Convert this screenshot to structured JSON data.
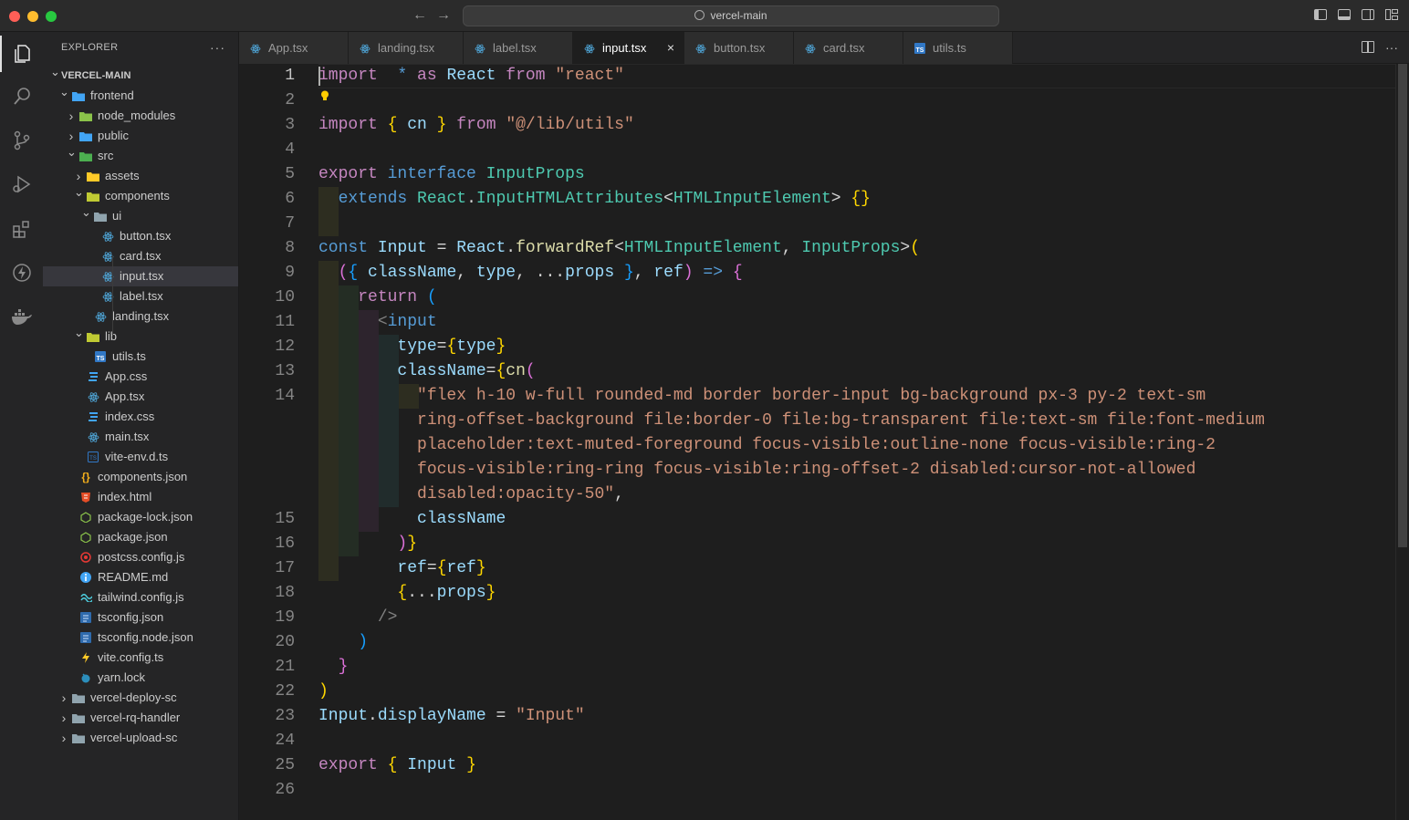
{
  "titlebar": {
    "search": "vercel-main",
    "back": "←",
    "forward": "→"
  },
  "sidebar": {
    "title": "EXPLORER",
    "more": "···",
    "tree": [
      {
        "label": "VERCEL-MAIN",
        "depth": 0,
        "type": "root",
        "expanded": true
      },
      {
        "label": "frontend",
        "depth": 1,
        "type": "folder",
        "expanded": true,
        "icon": "folder-web-icon"
      },
      {
        "label": "node_modules",
        "depth": 2,
        "type": "folder",
        "expanded": false,
        "icon": "folder-node-icon"
      },
      {
        "label": "public",
        "depth": 2,
        "type": "folder",
        "expanded": false,
        "icon": "folder-public-icon"
      },
      {
        "label": "src",
        "depth": 2,
        "type": "folder",
        "expanded": true,
        "icon": "folder-src-icon"
      },
      {
        "label": "assets",
        "depth": 3,
        "type": "folder",
        "expanded": false,
        "icon": "folder-assets-icon"
      },
      {
        "label": "components",
        "depth": 3,
        "type": "folder",
        "expanded": true,
        "icon": "folder-components-icon"
      },
      {
        "label": "ui",
        "depth": 4,
        "type": "folder",
        "expanded": true,
        "icon": "folder-ui-icon"
      },
      {
        "label": "button.tsx",
        "depth": 5,
        "type": "file",
        "icon": "react-icon"
      },
      {
        "label": "card.tsx",
        "depth": 5,
        "type": "file",
        "icon": "react-icon"
      },
      {
        "label": "input.tsx",
        "depth": 5,
        "type": "file",
        "icon": "react-icon",
        "selected": true
      },
      {
        "label": "label.tsx",
        "depth": 5,
        "type": "file",
        "icon": "react-icon"
      },
      {
        "label": "landing.tsx",
        "depth": 4,
        "type": "file",
        "icon": "react-icon"
      },
      {
        "label": "lib",
        "depth": 3,
        "type": "folder",
        "expanded": true,
        "icon": "folder-lib-icon"
      },
      {
        "label": "utils.ts",
        "depth": 4,
        "type": "file",
        "icon": "typescript-icon"
      },
      {
        "label": "App.css",
        "depth": 3,
        "type": "file",
        "icon": "css-icon"
      },
      {
        "label": "App.tsx",
        "depth": 3,
        "type": "file",
        "icon": "react-icon"
      },
      {
        "label": "index.css",
        "depth": 3,
        "type": "file",
        "icon": "css-icon"
      },
      {
        "label": "main.tsx",
        "depth": 3,
        "type": "file",
        "icon": "react-icon"
      },
      {
        "label": "vite-env.d.ts",
        "depth": 3,
        "type": "file",
        "icon": "typescript-def-icon"
      },
      {
        "label": "components.json",
        "depth": 2,
        "type": "file",
        "icon": "json-icon"
      },
      {
        "label": "index.html",
        "depth": 2,
        "type": "file",
        "icon": "html-icon"
      },
      {
        "label": "package-lock.json",
        "depth": 2,
        "type": "file",
        "icon": "nodejs-icon"
      },
      {
        "label": "package.json",
        "depth": 2,
        "type": "file",
        "icon": "nodejs-icon"
      },
      {
        "label": "postcss.config.js",
        "depth": 2,
        "type": "file",
        "icon": "postcss-icon"
      },
      {
        "label": "README.md",
        "depth": 2,
        "type": "file",
        "icon": "info-icon"
      },
      {
        "label": "tailwind.config.js",
        "depth": 2,
        "type": "file",
        "icon": "tailwind-icon"
      },
      {
        "label": "tsconfig.json",
        "depth": 2,
        "type": "file",
        "icon": "tsconfig-icon"
      },
      {
        "label": "tsconfig.node.json",
        "depth": 2,
        "type": "file",
        "icon": "tsconfig-icon"
      },
      {
        "label": "vite.config.ts",
        "depth": 2,
        "type": "file",
        "icon": "vite-icon"
      },
      {
        "label": "yarn.lock",
        "depth": 2,
        "type": "file",
        "icon": "yarn-icon"
      },
      {
        "label": "vercel-deploy-sc",
        "depth": 1,
        "type": "folder",
        "expanded": false,
        "icon": "folder-icon"
      },
      {
        "label": "vercel-rq-handler",
        "depth": 1,
        "type": "folder",
        "expanded": false,
        "icon": "folder-icon"
      },
      {
        "label": "vercel-upload-sc",
        "depth": 1,
        "type": "folder",
        "expanded": false,
        "icon": "folder-icon"
      }
    ]
  },
  "tabs": [
    {
      "label": "App.tsx",
      "icon": "react-icon"
    },
    {
      "label": "landing.tsx",
      "icon": "react-icon"
    },
    {
      "label": "label.tsx",
      "icon": "react-icon"
    },
    {
      "label": "input.tsx",
      "icon": "react-icon",
      "active": true,
      "close": "×"
    },
    {
      "label": "button.tsx",
      "icon": "react-icon"
    },
    {
      "label": "card.tsx",
      "icon": "react-icon"
    },
    {
      "label": "utils.ts",
      "icon": "typescript-icon"
    }
  ],
  "editor": {
    "active_line": 1,
    "lines": [
      {
        "n": "1",
        "tokens": [
          [
            "kw2",
            "import"
          ],
          [
            "",
            "  "
          ],
          [
            "kw",
            "*"
          ],
          [
            "",
            " "
          ],
          [
            "kw2",
            "as"
          ],
          [
            "",
            " "
          ],
          [
            "var",
            "React"
          ],
          [
            "",
            " "
          ],
          [
            "kw2",
            "from"
          ],
          [
            "",
            " "
          ],
          [
            "str",
            "\"react\""
          ]
        ]
      },
      {
        "n": "2",
        "tokens": []
      },
      {
        "n": "3",
        "tokens": [
          [
            "kw2",
            "import"
          ],
          [
            "",
            " "
          ],
          [
            "br1",
            "{"
          ],
          [
            "",
            " "
          ],
          [
            "var",
            "cn"
          ],
          [
            "",
            " "
          ],
          [
            "br1",
            "}"
          ],
          [
            "",
            " "
          ],
          [
            "kw2",
            "from"
          ],
          [
            "",
            " "
          ],
          [
            "str",
            "\"@/lib/utils\""
          ]
        ]
      },
      {
        "n": "4",
        "tokens": []
      },
      {
        "n": "5",
        "tokens": [
          [
            "kw2",
            "export"
          ],
          [
            "",
            " "
          ],
          [
            "kw",
            "interface"
          ],
          [
            "",
            " "
          ],
          [
            "ty",
            "InputProps"
          ]
        ]
      },
      {
        "n": "6",
        "tokens": [
          [
            "",
            "  "
          ],
          [
            "kw",
            "extends"
          ],
          [
            "",
            " "
          ],
          [
            "ty",
            "React"
          ],
          [
            "",
            "."
          ],
          [
            "ty",
            "InputHTMLAttributes"
          ],
          [
            "",
            "<"
          ],
          [
            "ty",
            "HTMLInputElement"
          ],
          [
            "",
            "> "
          ],
          [
            "br1",
            "{}"
          ]
        ]
      },
      {
        "n": "7",
        "tokens": []
      },
      {
        "n": "8",
        "tokens": [
          [
            "kw",
            "const"
          ],
          [
            "",
            " "
          ],
          [
            "var",
            "Input"
          ],
          [
            "",
            " = "
          ],
          [
            "var",
            "React"
          ],
          [
            "",
            "."
          ],
          [
            "fn",
            "forwardRef"
          ],
          [
            "",
            "<"
          ],
          [
            "ty",
            "HTMLInputElement"
          ],
          [
            "",
            ", "
          ],
          [
            "ty",
            "InputProps"
          ],
          [
            "",
            ">"
          ],
          [
            "br1",
            "("
          ]
        ]
      },
      {
        "n": "9",
        "tokens": [
          [
            "",
            "  "
          ],
          [
            "br2",
            "("
          ],
          [
            "br3",
            "{"
          ],
          [
            "",
            " "
          ],
          [
            "var",
            "className"
          ],
          [
            "",
            ", "
          ],
          [
            "var",
            "type"
          ],
          [
            "",
            ", ..."
          ],
          [
            "var",
            "props"
          ],
          [
            "",
            " "
          ],
          [
            "br3",
            "}"
          ],
          [
            "",
            ", "
          ],
          [
            "var",
            "ref"
          ],
          [
            "br2",
            ")"
          ],
          [
            "",
            " "
          ],
          [
            "kw",
            "=>"
          ],
          [
            "",
            " "
          ],
          [
            "br2",
            "{"
          ]
        ]
      },
      {
        "n": "10",
        "tokens": [
          [
            "",
            "    "
          ],
          [
            "kw2",
            "return"
          ],
          [
            "",
            " "
          ],
          [
            "br3",
            "("
          ]
        ]
      },
      {
        "n": "11",
        "tokens": [
          [
            "",
            "      "
          ],
          [
            "punc",
            "<"
          ],
          [
            "tag",
            "input"
          ]
        ]
      },
      {
        "n": "12",
        "tokens": [
          [
            "",
            "        "
          ],
          [
            "var",
            "type"
          ],
          [
            "",
            "="
          ],
          [
            "br1",
            "{"
          ],
          [
            "var",
            "type"
          ],
          [
            "br1",
            "}"
          ]
        ]
      },
      {
        "n": "13",
        "tokens": [
          [
            "",
            "        "
          ],
          [
            "var",
            "className"
          ],
          [
            "",
            "="
          ],
          [
            "br1",
            "{"
          ],
          [
            "fn",
            "cn"
          ],
          [
            "br2",
            "("
          ]
        ]
      },
      {
        "n": "14",
        "tokens": [
          [
            "",
            "          "
          ],
          [
            "str",
            "\"flex h-10 w-full rounded-md border border-input bg-background px-3 py-2 text-sm"
          ]
        ]
      },
      {
        "n": "",
        "tokens": [
          [
            "",
            "          "
          ],
          [
            "str",
            "ring-offset-background file:border-0 file:bg-transparent file:text-sm file:font-medium"
          ]
        ]
      },
      {
        "n": "",
        "tokens": [
          [
            "",
            "          "
          ],
          [
            "str",
            "placeholder:text-muted-foreground focus-visible:outline-none focus-visible:ring-2"
          ]
        ]
      },
      {
        "n": "",
        "tokens": [
          [
            "",
            "          "
          ],
          [
            "str",
            "focus-visible:ring-ring focus-visible:ring-offset-2 disabled:cursor-not-allowed"
          ]
        ]
      },
      {
        "n": "",
        "tokens": [
          [
            "",
            "          "
          ],
          [
            "str",
            "disabled:opacity-50\""
          ],
          [
            "",
            ","
          ]
        ]
      },
      {
        "n": "15",
        "tokens": [
          [
            "",
            "          "
          ],
          [
            "var",
            "className"
          ]
        ]
      },
      {
        "n": "16",
        "tokens": [
          [
            "",
            "        "
          ],
          [
            "br2",
            ")"
          ],
          [
            "br1",
            "}"
          ]
        ]
      },
      {
        "n": "17",
        "tokens": [
          [
            "",
            "        "
          ],
          [
            "var",
            "ref"
          ],
          [
            "",
            "="
          ],
          [
            "br1",
            "{"
          ],
          [
            "var",
            "ref"
          ],
          [
            "br1",
            "}"
          ]
        ]
      },
      {
        "n": "18",
        "tokens": [
          [
            "",
            "        "
          ],
          [
            "br1",
            "{"
          ],
          [
            "",
            "..."
          ],
          [
            "var",
            "props"
          ],
          [
            "br1",
            "}"
          ]
        ]
      },
      {
        "n": "19",
        "tokens": [
          [
            "",
            "      "
          ],
          [
            "punc",
            "/>"
          ]
        ]
      },
      {
        "n": "20",
        "tokens": [
          [
            "",
            "    "
          ],
          [
            "br3",
            ")"
          ]
        ]
      },
      {
        "n": "21",
        "tokens": [
          [
            "",
            "  "
          ],
          [
            "br2",
            "}"
          ]
        ]
      },
      {
        "n": "22",
        "tokens": [
          [
            "br1",
            ")"
          ]
        ]
      },
      {
        "n": "23",
        "tokens": [
          [
            "var",
            "Input"
          ],
          [
            "",
            "."
          ],
          [
            "var",
            "displayName"
          ],
          [
            "",
            " = "
          ],
          [
            "str",
            "\"Input\""
          ]
        ]
      },
      {
        "n": "24",
        "tokens": []
      },
      {
        "n": "25",
        "tokens": [
          [
            "kw2",
            "export"
          ],
          [
            "",
            " "
          ],
          [
            "br1",
            "{"
          ],
          [
            "",
            " "
          ],
          [
            "var",
            "Input"
          ],
          [
            "",
            " "
          ],
          [
            "br1",
            "}"
          ]
        ]
      },
      {
        "n": "26",
        "tokens": []
      }
    ]
  },
  "colors": {
    "background": "#1e1e1e",
    "sidebar": "#252526",
    "react": "#4fa6d8",
    "keyword": "#569cd6",
    "control": "#c586c0",
    "string": "#ce9178"
  }
}
